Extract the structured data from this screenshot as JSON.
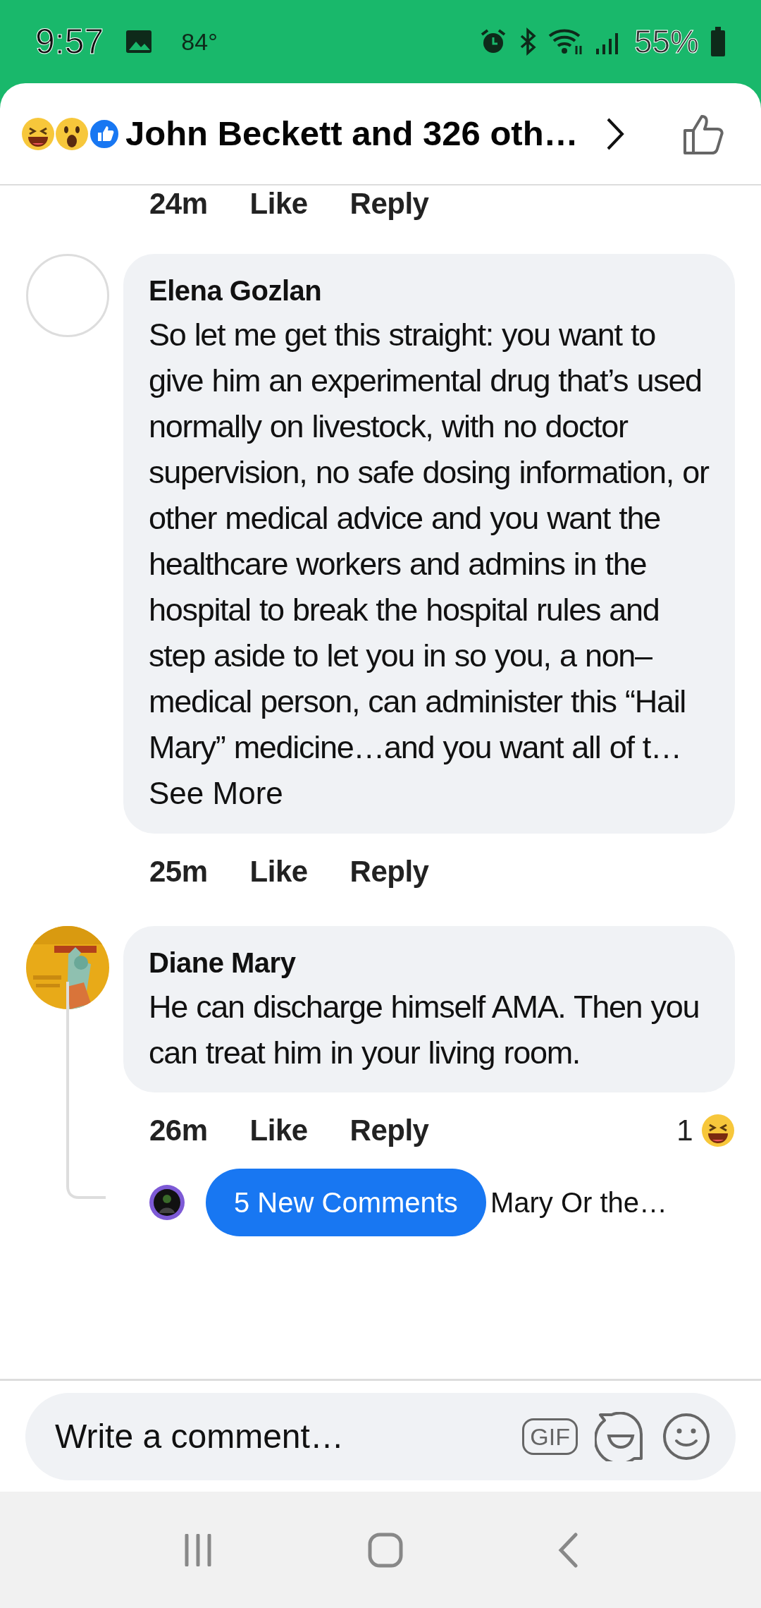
{
  "status_bar": {
    "time": "9:57",
    "temperature": "84°",
    "battery": "55%"
  },
  "header": {
    "title": "John Beckett and 326 oth…"
  },
  "previous_actions": {
    "time": "24m",
    "like": "Like",
    "reply": "Reply"
  },
  "comments": [
    {
      "author": "Elena Gozlan",
      "avatar": {
        "kind": "blank"
      },
      "text": "So let me get this straight:  you want to give him an experimental drug that’s used normally on livestock, with no doctor supervision, no safe dosing information, or other medical advice and you want the healthcare workers and admins in the hospital to break the hospital rules and step aside to let you in so you, a non–medical person, can administer this “Hail Mary” medicine…and you want  all of t…",
      "see_more": "See More",
      "time": "25m",
      "like": "Like",
      "reply": "Reply"
    },
    {
      "author": "Diane Mary",
      "text": "He can discharge himself AMA. Then you can treat him in your living room.",
      "time": "26m",
      "like": "Like",
      "reply": "Reply",
      "reaction_count": "1"
    }
  ],
  "thread_reply": {
    "text": "Mary Or the…"
  },
  "new_comments_button": "5 New Comments",
  "composer": {
    "placeholder": "Write a comment…",
    "gif": "GIF"
  }
}
